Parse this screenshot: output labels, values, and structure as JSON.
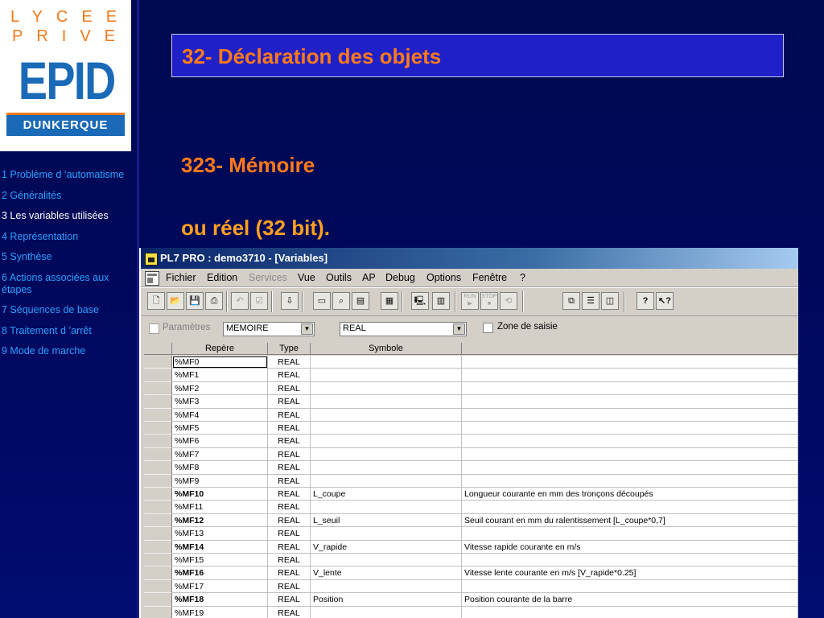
{
  "logo": {
    "line1": "LYCEE",
    "line2": "PRIVE",
    "name": "EPID",
    "city": "DUNKERQUE"
  },
  "nav": [
    {
      "label": "1 Problème d ’automatisme",
      "active": false
    },
    {
      "label": "2 Généralités",
      "active": false
    },
    {
      "label": "3 Les variables utilisées",
      "active": true
    },
    {
      "label": "4 Représentation",
      "active": false
    },
    {
      "label": "5 Synthèse",
      "active": false
    },
    {
      "label": "6 Actions associées aux étapes",
      "active": false
    },
    {
      "label": "7 Séquences de base",
      "active": false
    },
    {
      "label": "8 Traitement d ’arrêt",
      "active": false
    },
    {
      "label": "9 Mode de marche",
      "active": false
    }
  ],
  "slide": {
    "title": "32- Déclaration des objets",
    "subtitle": "323- Mémoire",
    "text": "ou réel (32 bit)."
  },
  "window": {
    "title": "PL7 PRO : demo3710 - [Variables]",
    "menu": [
      "Fichier",
      "Edition",
      "Services",
      "Vue",
      "Outils",
      "AP",
      "Debug",
      "Options",
      "Fenêtre",
      "?"
    ],
    "menu_disabled": [
      "Services"
    ],
    "toolbar_run": "RUN",
    "toolbar_stop": "STOP",
    "params_label": "Paramètres",
    "combo_memory": "MEMOIRE",
    "combo_type": "REAL",
    "zone_saisie": "Zone de saisie",
    "columns": [
      "Repère",
      "Type",
      "Symbole"
    ],
    "rows": [
      {
        "repere": "%MF0",
        "type": "REAL",
        "symbole": "",
        "comment": "",
        "bold": false
      },
      {
        "repere": "%MF1",
        "type": "REAL",
        "symbole": "",
        "comment": "",
        "bold": false
      },
      {
        "repere": "%MF2",
        "type": "REAL",
        "symbole": "",
        "comment": "",
        "bold": false
      },
      {
        "repere": "%MF3",
        "type": "REAL",
        "symbole": "",
        "comment": "",
        "bold": false
      },
      {
        "repere": "%MF4",
        "type": "REAL",
        "symbole": "",
        "comment": "",
        "bold": false
      },
      {
        "repere": "%MF5",
        "type": "REAL",
        "symbole": "",
        "comment": "",
        "bold": false
      },
      {
        "repere": "%MF6",
        "type": "REAL",
        "symbole": "",
        "comment": "",
        "bold": false
      },
      {
        "repere": "%MF7",
        "type": "REAL",
        "symbole": "",
        "comment": "",
        "bold": false
      },
      {
        "repere": "%MF8",
        "type": "REAL",
        "symbole": "",
        "comment": "",
        "bold": false
      },
      {
        "repere": "%MF9",
        "type": "REAL",
        "symbole": "",
        "comment": "",
        "bold": false
      },
      {
        "repere": "%MF10",
        "type": "REAL",
        "symbole": "L_coupe",
        "comment": "Longueur courante en mm des tronçons découpés",
        "bold": true
      },
      {
        "repere": "%MF11",
        "type": "REAL",
        "symbole": "",
        "comment": "",
        "bold": false
      },
      {
        "repere": "%MF12",
        "type": "REAL",
        "symbole": "L_seuil",
        "comment": "Seuil courant en mm du ralentissement [L_coupe*0,7]",
        "bold": true
      },
      {
        "repere": "%MF13",
        "type": "REAL",
        "symbole": "",
        "comment": "",
        "bold": false
      },
      {
        "repere": "%MF14",
        "type": "REAL",
        "symbole": "V_rapide",
        "comment": "Vitesse rapide courante en m/s",
        "bold": true
      },
      {
        "repere": "%MF15",
        "type": "REAL",
        "symbole": "",
        "comment": "",
        "bold": false
      },
      {
        "repere": "%MF16",
        "type": "REAL",
        "symbole": "V_lente",
        "comment": "Vitesse lente courante en m/s [V_rapide*0.25]",
        "bold": true
      },
      {
        "repere": "%MF17",
        "type": "REAL",
        "symbole": "",
        "comment": "",
        "bold": false
      },
      {
        "repere": "%MF18",
        "type": "REAL",
        "symbole": "Position",
        "comment": "Position courante de la barre",
        "bold": true
      },
      {
        "repere": "%MF19",
        "type": "REAL",
        "symbole": "",
        "comment": "",
        "bold": false
      }
    ]
  },
  "colors": {
    "accent": "#ff7a1a",
    "nav": "#2aa0ff",
    "title_box": "#2020c8"
  }
}
